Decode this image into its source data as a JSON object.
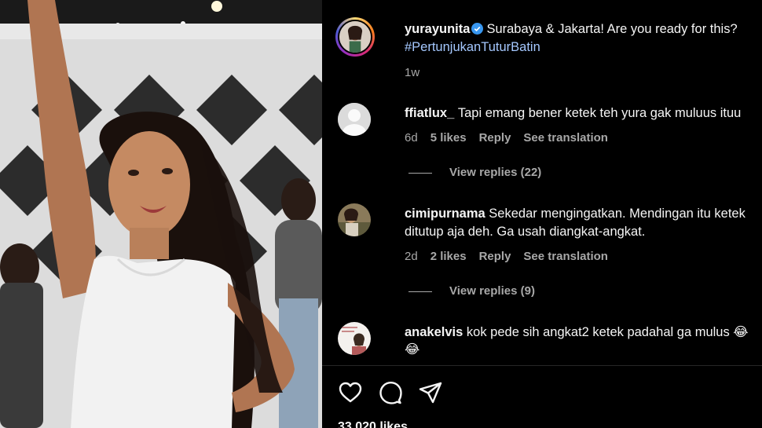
{
  "post": {
    "username": "yurayunita",
    "caption": "Surabaya & Jakarta! Are you ready for this?",
    "hashtag": "#PertunjukanTuturBatin",
    "time": "1w"
  },
  "comments": [
    {
      "username": "ffiatlux_",
      "text": "Tapi emang bener ketek teh yura gak muluus ituu",
      "time": "6d",
      "likes": "5 likes",
      "reply_label": "Reply",
      "translation_label": "See translation",
      "view_replies": "View replies (22)"
    },
    {
      "username": "cimipurnama",
      "text_line1": "Sekedar mengingatkan. Mendingan itu ketek",
      "text_line2": "ditutup aja deh. Ga usah diangkat-angkat.",
      "time": "2d",
      "likes": "2 likes",
      "reply_label": "Reply",
      "translation_label": "See translation",
      "view_replies": "View replies (9)"
    },
    {
      "username": "anakelvis",
      "text_line1": "kok pede sih angkat2 ketek padahal ga mulus 😂",
      "text_line2": "😂"
    }
  ],
  "likes_count": "33,020 likes",
  "icons": {
    "verified": "verified-badge-icon",
    "like": "heart-icon",
    "comment": "comment-bubble-icon",
    "share": "paper-plane-icon"
  },
  "colors": {
    "background": "#000000",
    "verified": "#3897f0",
    "hashtag": "#a5c8ff",
    "muted": "#a8a8a8"
  }
}
